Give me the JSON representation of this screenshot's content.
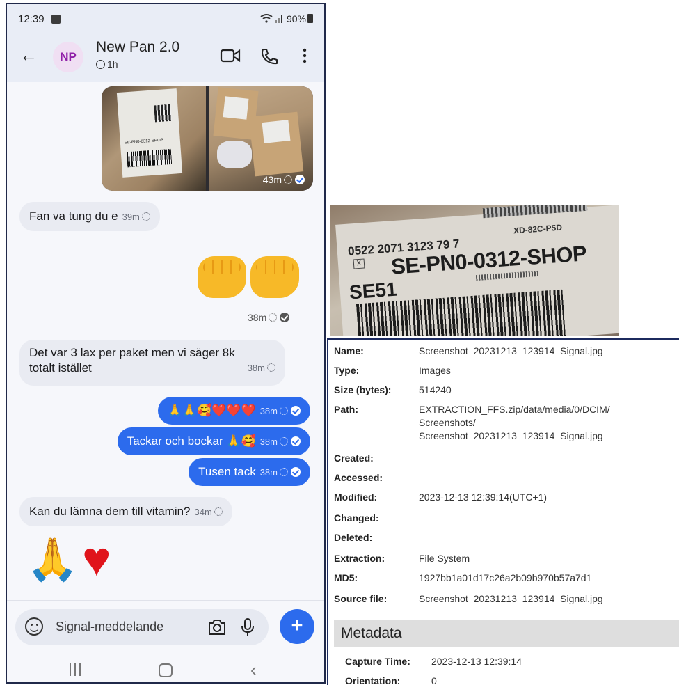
{
  "phone": {
    "status_bar": {
      "time": "12:39",
      "battery": "90%"
    },
    "header": {
      "avatar_initials": "NP",
      "contact_name": "New Pan 2.0",
      "disappearing_timer": "1h"
    },
    "messages": [
      {
        "direction": "outgoing",
        "type": "image",
        "time": "43m"
      },
      {
        "direction": "incoming",
        "text": "Fan va tung du e",
        "time": "39m"
      },
      {
        "direction": "outgoing",
        "type": "emoji",
        "text": "👊👊",
        "time": "38m"
      },
      {
        "direction": "incoming",
        "text_line1": "Det var 3 lax per paket men vi säger 8k",
        "text_line2": "totalt istället",
        "time": "38m"
      },
      {
        "direction": "outgoing",
        "text": "🙏🙏🥰❤️❤️❤️",
        "time": "38m"
      },
      {
        "direction": "outgoing",
        "text": "Tackar och bockar 🙏🥰",
        "time": "38m"
      },
      {
        "direction": "outgoing",
        "text": "Tusen tack",
        "time": "38m"
      },
      {
        "direction": "incoming",
        "text": "Kan du lämna dem till vitamin?",
        "time": "34m"
      },
      {
        "direction": "incoming",
        "type": "emoji",
        "text": "🙏❤️"
      }
    ],
    "composer": {
      "placeholder": "Signal-meddelande"
    }
  },
  "crop": {
    "top_code": "XD-82C-P5D",
    "ref_line": "0522 2071 3123 79 7",
    "x_mark": "X",
    "code": "SE-PN0-0312-SHOP",
    "se": "SE51"
  },
  "properties": {
    "rows": [
      {
        "key": "Name:",
        "value": "Screenshot_20231213_123914_Signal.jpg"
      },
      {
        "key": "Type:",
        "value": "Images"
      },
      {
        "key": "Size (bytes):",
        "value": "514240"
      },
      {
        "key": "Path:",
        "value_lines": [
          "EXTRACTION_FFS.zip/data/media/0/DCIM/",
          "Screenshots/",
          "Screenshot_20231213_123914_Signal.jpg"
        ]
      },
      {
        "key": "Created:",
        "value": ""
      },
      {
        "key": "Accessed:",
        "value": ""
      },
      {
        "key": "Modified:",
        "value": "2023-12-13 12:39:14(UTC+1)"
      },
      {
        "key": "Changed:",
        "value": ""
      },
      {
        "key": "Deleted:",
        "value": ""
      },
      {
        "key": "Extraction:",
        "value": "File System"
      },
      {
        "key": "MD5:",
        "value": "1927bb1a01d17c26a2b09b970b57a7d1"
      },
      {
        "key": "Source file:",
        "value": "Screenshot_20231213_123914_Signal.jpg"
      }
    ],
    "metadata_heading": "Metadata",
    "metadata": [
      {
        "key": "Capture Time:",
        "value": "2023-12-13 12:39:14"
      },
      {
        "key": "Orientation:",
        "value": "0"
      }
    ]
  }
}
